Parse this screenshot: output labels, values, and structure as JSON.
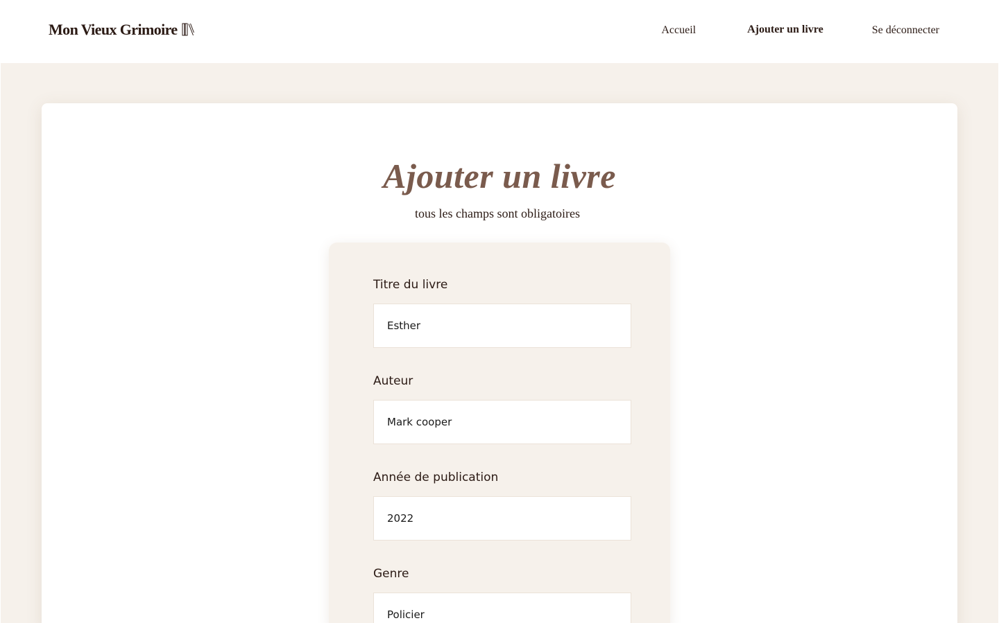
{
  "header": {
    "logo_text": "Mon Vieux Grimoire",
    "logo_icon": "books-icon",
    "nav": {
      "home": "Accueil",
      "add_book": "Ajouter un livre",
      "logout": "Se déconnecter"
    }
  },
  "main": {
    "title": "Ajouter un livre",
    "subtitle": "tous les champs sont obligatoires"
  },
  "form": {
    "fields": [
      {
        "label": "Titre du livre",
        "value": "Esther"
      },
      {
        "label": "Auteur",
        "value": "Mark cooper"
      },
      {
        "label": "Année de publication",
        "value": "2022"
      },
      {
        "label": "Genre",
        "value": "Policier"
      }
    ]
  },
  "colors": {
    "accent": "#7a5b4d",
    "page_background": "#f6f1eb",
    "text": "#2b1a14"
  }
}
